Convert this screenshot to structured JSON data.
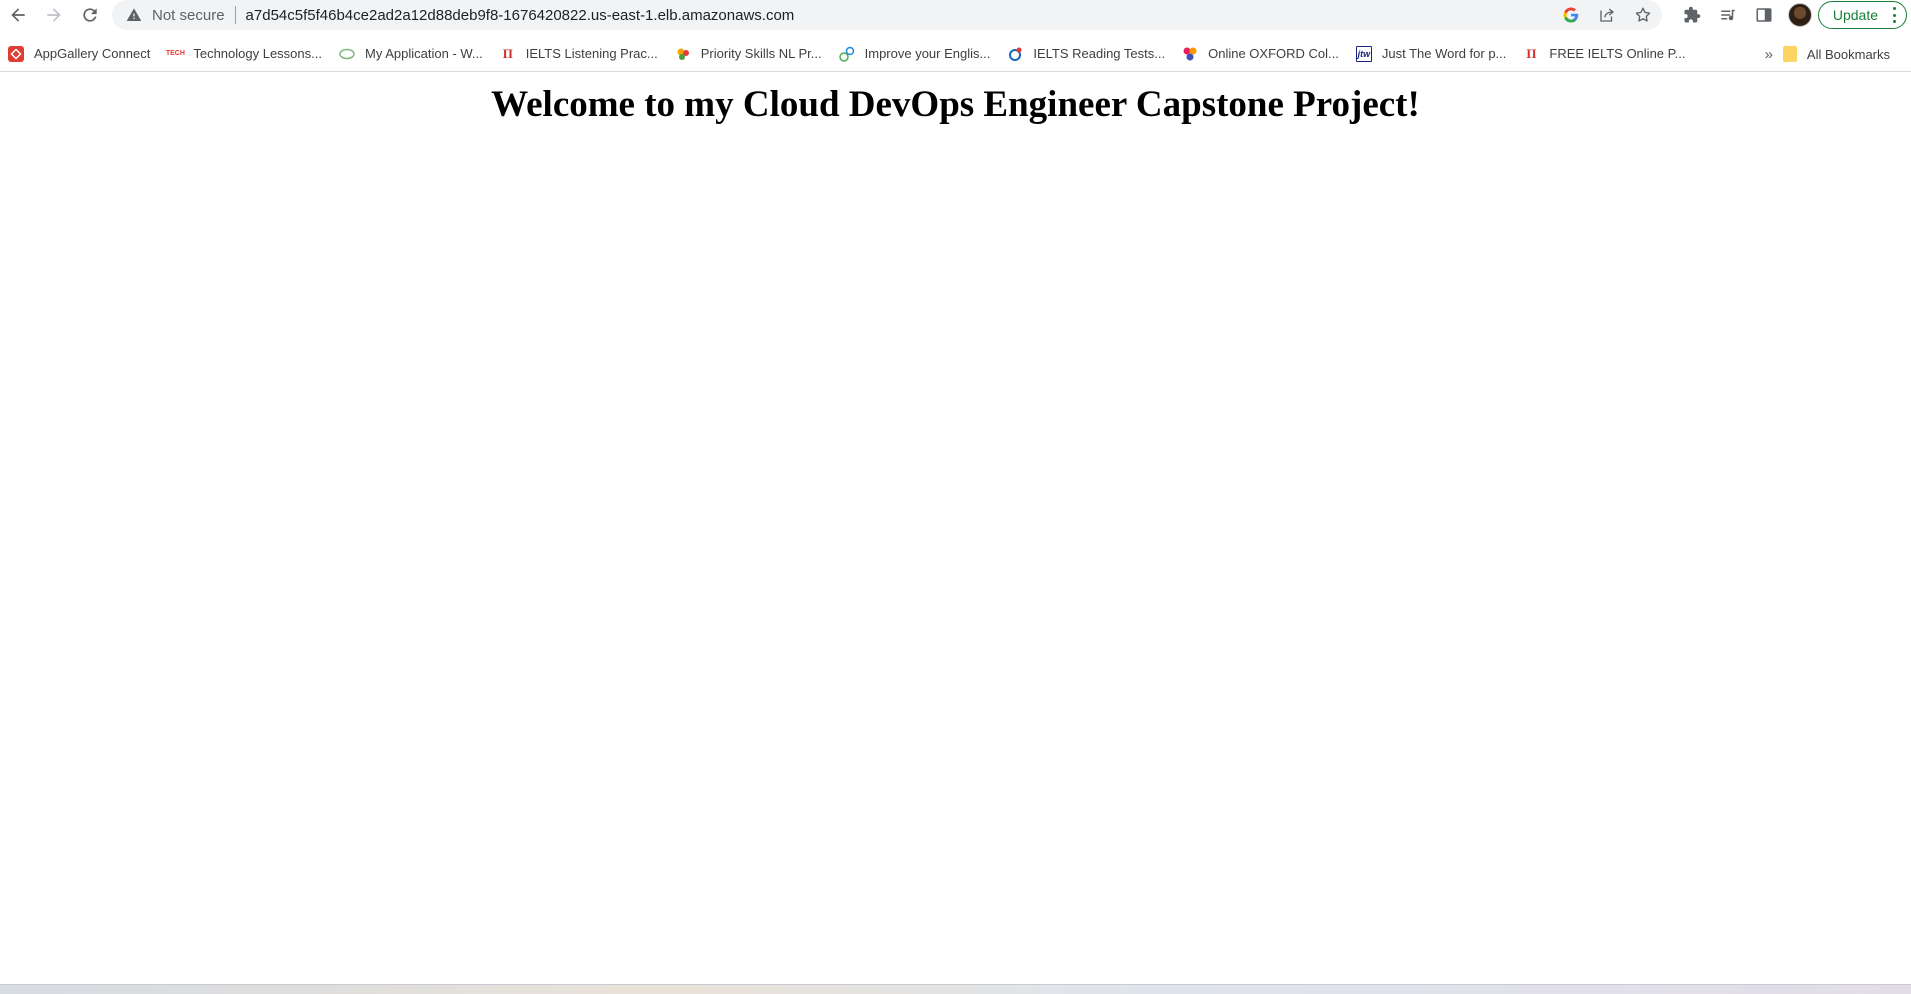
{
  "browser": {
    "security_label": "Not secure",
    "url": "a7d54c5f5f46b4ce2ad2a12d88deb9f8-1676420822.us-east-1.elb.amazonaws.com",
    "update_label": "Update",
    "icons": {
      "back": "back-arrow-icon",
      "forward": "forward-arrow-icon",
      "reload": "reload-icon",
      "warning": "warning-icon",
      "google": "google-icon",
      "share": "share-icon",
      "star": "star-icon",
      "extensions": "puzzle-icon",
      "reading_list": "reading-list-icon",
      "side_panel": "side-panel-icon",
      "menu": "more-vert-icon"
    },
    "accent_colors": {
      "update": "#188038",
      "warning": "#5f6368"
    }
  },
  "bookmarks": {
    "items": [
      {
        "label": "AppGallery Connect",
        "icon": "appgallery-icon",
        "color": "#e03c31"
      },
      {
        "label": "Technology Lessons...",
        "icon": "tech-lessons-icon",
        "color": "#e53935"
      },
      {
        "label": "My Application - W...",
        "icon": "my-application-icon",
        "color": "#7fb77e"
      },
      {
        "label": "IELTS Listening Prac...",
        "icon": "ielts-icon",
        "color": "#d32f2f"
      },
      {
        "label": "Priority Skills NL Pr...",
        "icon": "priority-skills-icon",
        "color": "#f4a300"
      },
      {
        "label": "Improve your Englis...",
        "icon": "improve-english-icon",
        "color": "#4caf50"
      },
      {
        "label": "IELTS Reading Tests...",
        "icon": "ielts-reading-icon",
        "color": "#1565c0"
      },
      {
        "label": "Online OXFORD Col...",
        "icon": "oxford-icon",
        "color": "#e91e63"
      },
      {
        "label": "Just The Word for p...",
        "icon": "just-the-word-icon",
        "color": "#1a237e"
      },
      {
        "label": "FREE IELTS Online P...",
        "icon": "free-ielts-icon",
        "color": "#d32f2f"
      }
    ],
    "overflow_label": "»",
    "all_bookmarks_label": "All Bookmarks"
  },
  "page": {
    "heading": "Welcome to my Cloud DevOps Engineer Capstone Project!"
  }
}
